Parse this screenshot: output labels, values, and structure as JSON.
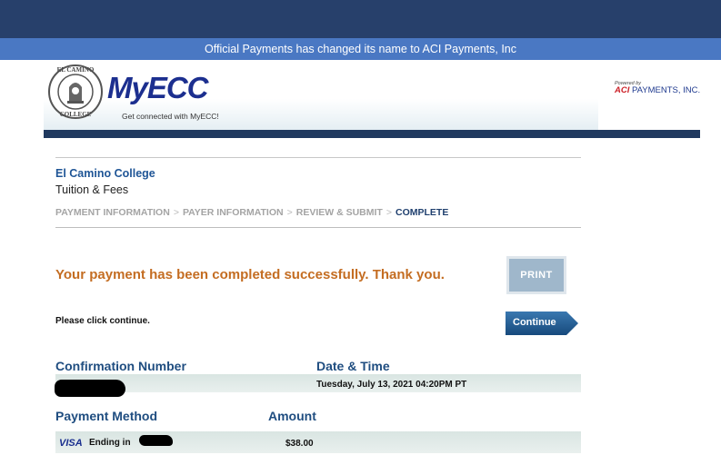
{
  "notice": "Official Payments has changed its name to ACI Payments, Inc",
  "header": {
    "seal_text_top": "EL CAMINO",
    "seal_text_bottom": "COLLEGE",
    "logo": "MyECC",
    "tagline": "Get connected with MyECC!",
    "powered_by": "Powered by",
    "aci": "ACI",
    "aci_rest": " PAYMENTS, INC."
  },
  "merchant": {
    "name": "El Camino College",
    "type": "Tuition & Fees"
  },
  "steps": [
    {
      "label": "PAYMENT INFORMATION"
    },
    {
      "label": "PAYER INFORMATION"
    },
    {
      "label": "REVIEW & SUBMIT"
    },
    {
      "label": "COMPLETE"
    }
  ],
  "step_separator": ">",
  "success_message": "Your payment has been completed successfully. Thank you.",
  "print_label": "PRINT",
  "instruction": "Please click continue.",
  "continue_label": "Continue",
  "confirmation": {
    "number_label": "Confirmation Number",
    "datetime_label": "Date & Time",
    "datetime_value": "Tuesday, July 13, 2021 04:20PM PT"
  },
  "payment": {
    "method_label": "Payment Method",
    "amount_label": "Amount",
    "card_brand": "VISA",
    "ending_label": "Ending in",
    "amount_value": "$38.00"
  },
  "colors": {
    "top_bar": "#27406b",
    "notice_bar": "#4a78c3",
    "success_text": "#c46d22",
    "label_blue": "#1f4d80",
    "button_blue": "#1f5a8f"
  }
}
